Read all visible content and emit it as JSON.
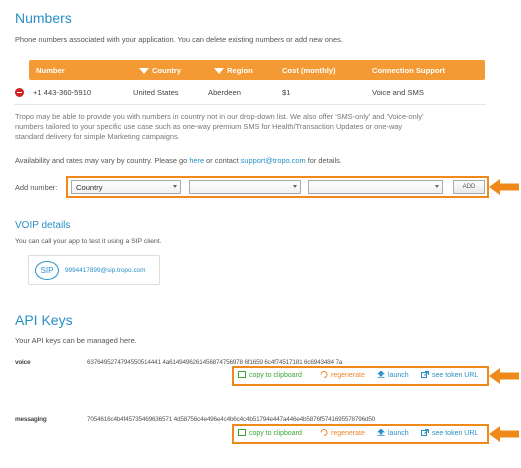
{
  "numbers": {
    "title": "Numbers",
    "description": "Phone numbers associated with your application. You can delete existing numbers or add new ones.",
    "columns": [
      "Number",
      "Country",
      "Region",
      "Cost (monthly)",
      "Connection Support"
    ],
    "row": {
      "number": "+1 443-360-5910",
      "country": "United States",
      "region": "Aberdeen",
      "cost": "$1",
      "support": "Voice and SMS"
    },
    "info_line1": "Tropo may be able to provide you with numbers in country not in our drop-down list. We also offer 'SMS-only' and 'Voice-only'",
    "info_line2": "numbers tailored to your specific use case such as one-way premium SMS for Health/Transaction Updates or one-way",
    "info_line3": "standard delivery for simple Marketing campaigns.",
    "avail_prefix": "Availability and rates may vary by country. Please go ",
    "avail_here": "here",
    "avail_mid": " or contact ",
    "avail_email": "support@tropo.com",
    "avail_suffix": " for details.",
    "add_label": "Add number:",
    "select_country": "Country",
    "select_region": "",
    "select_city": "",
    "add_button": "ADD"
  },
  "voip": {
    "title": "VOIP details",
    "description": "You can call your app to test it using a SIP client.",
    "sip_label": "SIP",
    "sip_address": "9994417899@sip.tropo.com"
  },
  "api": {
    "title": "API Keys",
    "description": "Your API keys can be managed here.",
    "keys": [
      {
        "name": "voice",
        "value": "6376495274794550514441 4a6149496261456874756978 6f1659 6c4f74517181 6c6943484 7a",
        "copy": "copy to clipboard",
        "regenerate": "regenerate",
        "launch": "launch",
        "token": "see token URL"
      },
      {
        "name": "messaging",
        "value": "7054616c4b4f45735469636571 4d58756c4e496e4c4b6c4c4b51794e447a446e4b5876f5741695578796d50",
        "copy": "copy to clipboard",
        "regenerate": "regenerate",
        "launch": "launch",
        "token": "see token URL"
      }
    ]
  },
  "colors": {
    "accent": "#2a8fc7",
    "header_orange": "#f39a34",
    "highlight_orange": "#ef8a1a",
    "copy_green": "#3aa63a",
    "regenerate_orange": "#e8882a",
    "delete_red": "#cc2222"
  },
  "icons": [
    "delete-icon",
    "sort-down-icon",
    "chevron-down-icon",
    "arrow-left-icon",
    "clipboard-icon",
    "refresh-icon",
    "upload-icon",
    "external-link-icon"
  ]
}
